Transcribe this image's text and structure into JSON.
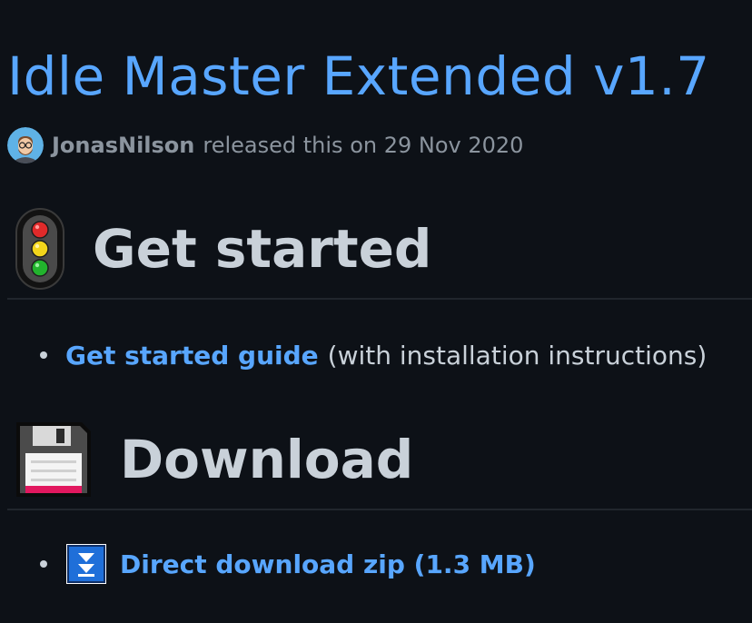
{
  "release": {
    "title": "Idle Master Extended v1.7",
    "author": "JonasNilson",
    "released_text": "released this on 29 Nov 2020"
  },
  "sections": {
    "get_started": {
      "heading": "Get started",
      "icon": "traffic-light-icon",
      "items": [
        {
          "link": "Get started guide",
          "suffix": "(with installation instructions)"
        }
      ]
    },
    "download": {
      "heading": "Download",
      "icon": "floppy-disk-icon",
      "items": [
        {
          "icon": "download-arrow-icon",
          "link": "Direct download zip (1.3 MB)"
        }
      ]
    }
  },
  "colors": {
    "background": "#0d1117",
    "link": "#58a6ff",
    "text": "#c9d1d9",
    "muted": "#8b949e"
  }
}
